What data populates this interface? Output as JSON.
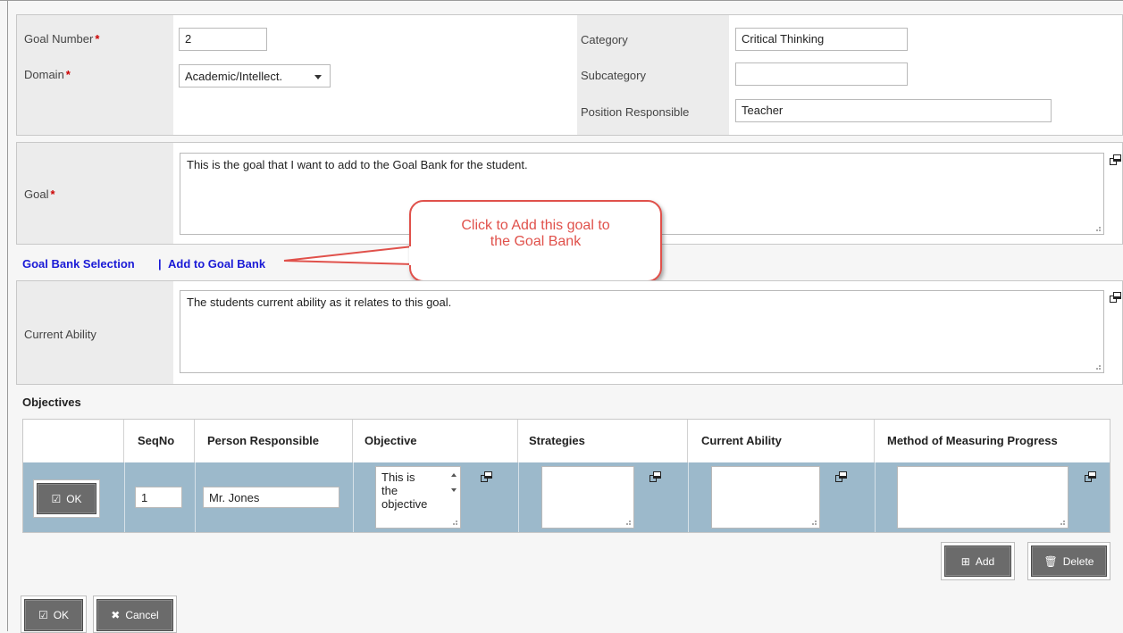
{
  "header": {
    "goal_number_label": "Goal Number",
    "goal_number_value": "2",
    "domain_label": "Domain",
    "domain_value": "Academic/Intellect.",
    "category_label": "Category",
    "category_value": "Critical Thinking",
    "subcategory_label": "Subcategory",
    "subcategory_value": "",
    "position_label": "Position Responsible",
    "position_value": "Teacher",
    "required_mark": "*"
  },
  "goal": {
    "label": "Goal",
    "text": "This is the goal that I want to add to the Goal Bank for the student."
  },
  "links": {
    "goal_bank_selection": "Goal Bank Selection",
    "separator": "|",
    "add_to_goal_bank": "Add to Goal Bank"
  },
  "callout": {
    "line1": "Click to Add this goal to",
    "line2": "the Goal Bank"
  },
  "current_ability": {
    "label": "Current Ability",
    "text": "The students current ability as it relates to this goal."
  },
  "objectives": {
    "title": "Objectives",
    "columns": [
      "SeqNo",
      "Person Responsible",
      "Objective",
      "Strategies",
      "Current Ability",
      "Method of Measuring Progress"
    ],
    "row": {
      "ok_label": "OK",
      "seqno": "1",
      "person": "Mr. Jones",
      "objective_lines": [
        "This is",
        "the",
        "objective"
      ],
      "strategies": "",
      "current_ability": "",
      "method": ""
    },
    "add_label": "Add",
    "delete_label": "Delete"
  },
  "footer": {
    "ok_label": "OK",
    "cancel_label": "Cancel"
  }
}
